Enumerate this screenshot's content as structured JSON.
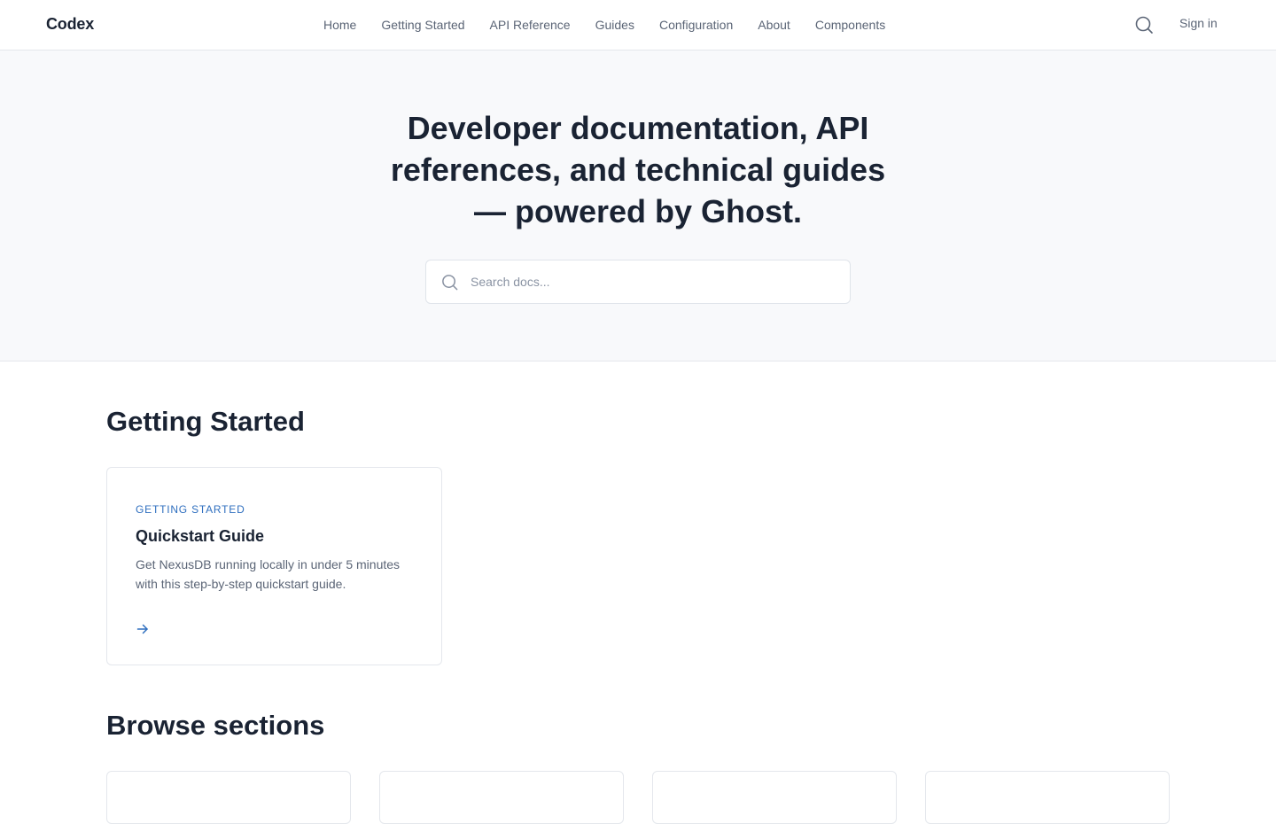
{
  "header": {
    "logo": "Codex",
    "nav": [
      {
        "label": "Home"
      },
      {
        "label": "Getting Started"
      },
      {
        "label": "API Reference"
      },
      {
        "label": "Guides"
      },
      {
        "label": "Configuration"
      },
      {
        "label": "About"
      },
      {
        "label": "Components"
      }
    ],
    "search_icon": "search-icon",
    "signin_label": "Sign in"
  },
  "hero": {
    "title": "Developer documentation, API references, and technical guides — powered by Ghost.",
    "search": {
      "placeholder": "Search docs...",
      "value": "",
      "icon": "search-icon"
    }
  },
  "getting_started": {
    "title": "Getting Started",
    "cards": [
      {
        "tag": "Getting Started",
        "title": "Quickstart Guide",
        "description": "Get NexusDB running locally in under 5 minutes with this step-by-step quickstart guide.",
        "icon": "arrow-right-icon"
      }
    ]
  },
  "browse": {
    "title": "Browse sections"
  },
  "colors": {
    "accent": "#2f6fbf",
    "text_primary": "#1a2333",
    "text_muted": "#5b6576",
    "border": "#e4e7ec",
    "hero_bg": "#f8f9fb"
  }
}
